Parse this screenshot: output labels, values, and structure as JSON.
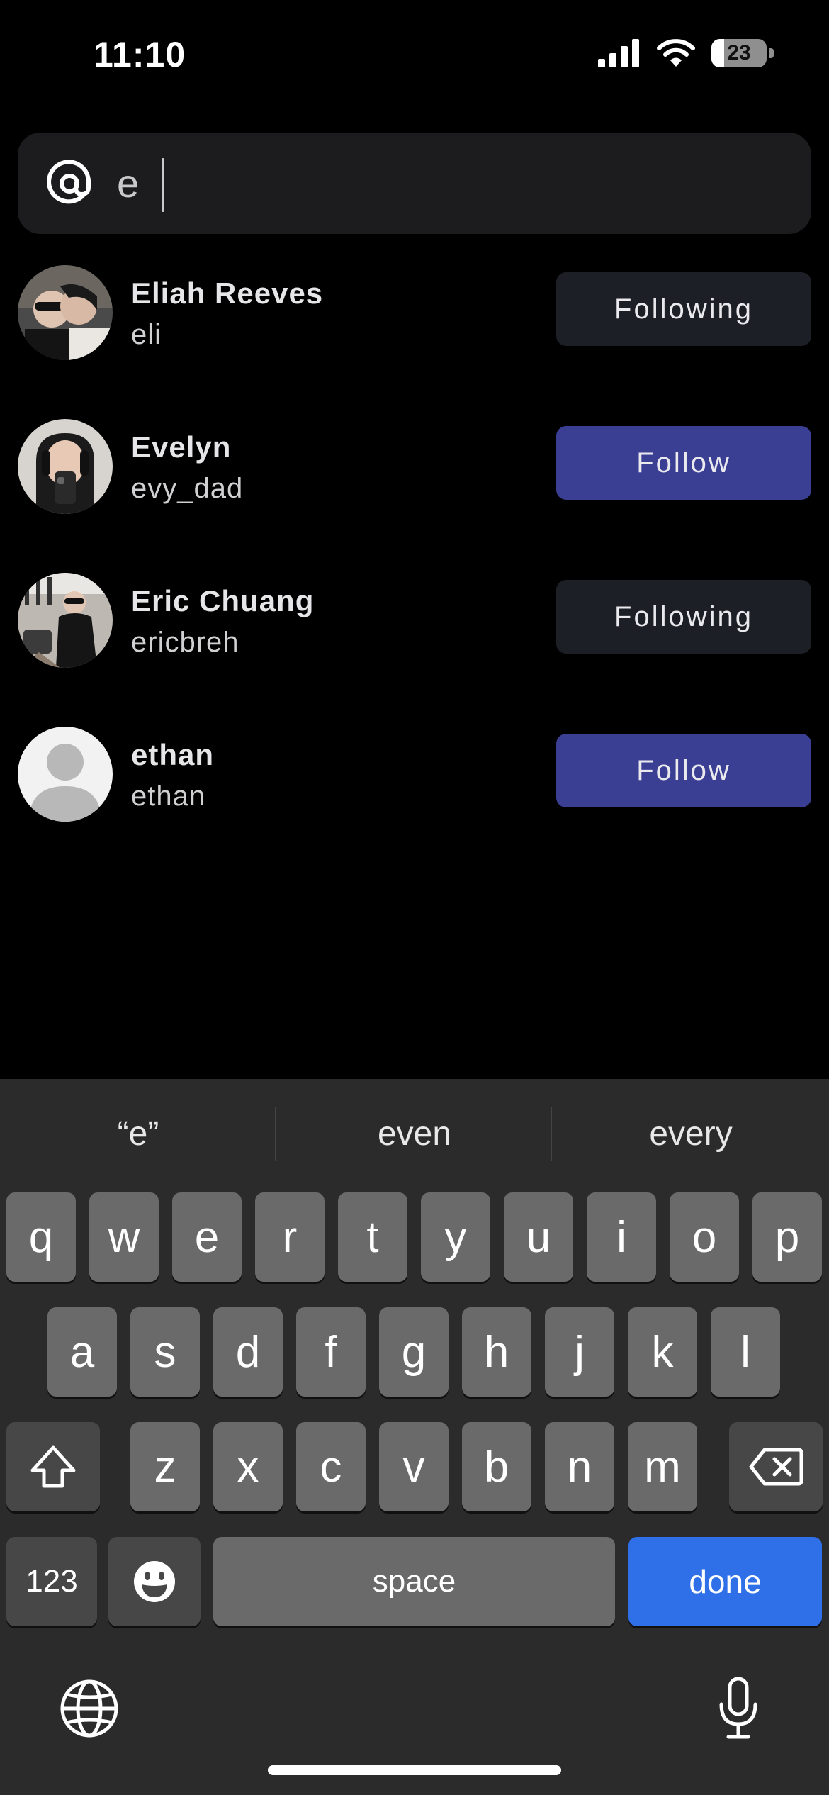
{
  "status_bar": {
    "time": "11:10",
    "battery": "23"
  },
  "search": {
    "value": "e",
    "icon": "at-sign-icon"
  },
  "results": [
    {
      "name": "Eliah Reeves",
      "handle": "eli",
      "button": "Following",
      "state": "following"
    },
    {
      "name": "Evelyn",
      "handle": "evy_dad",
      "button": "Follow",
      "state": "follow"
    },
    {
      "name": "Eric Chuang",
      "handle": "ericbreh",
      "button": "Following",
      "state": "following"
    },
    {
      "name": "ethan",
      "handle": "ethan",
      "button": "Follow",
      "state": "follow"
    }
  ],
  "keyboard": {
    "suggestions": [
      "“e”",
      "even",
      "every"
    ],
    "row1": [
      "q",
      "w",
      "e",
      "r",
      "t",
      "y",
      "u",
      "i",
      "o",
      "p"
    ],
    "row2": [
      "a",
      "s",
      "d",
      "f",
      "g",
      "h",
      "j",
      "k",
      "l"
    ],
    "row3": [
      "z",
      "x",
      "c",
      "v",
      "b",
      "n",
      "m"
    ],
    "numbers_key": "123",
    "space_key": "space",
    "done_key": "done"
  },
  "colors": {
    "follow_button": "#3a3f94",
    "following_button": "#1d1f26",
    "done_key": "#2f6fe8"
  }
}
